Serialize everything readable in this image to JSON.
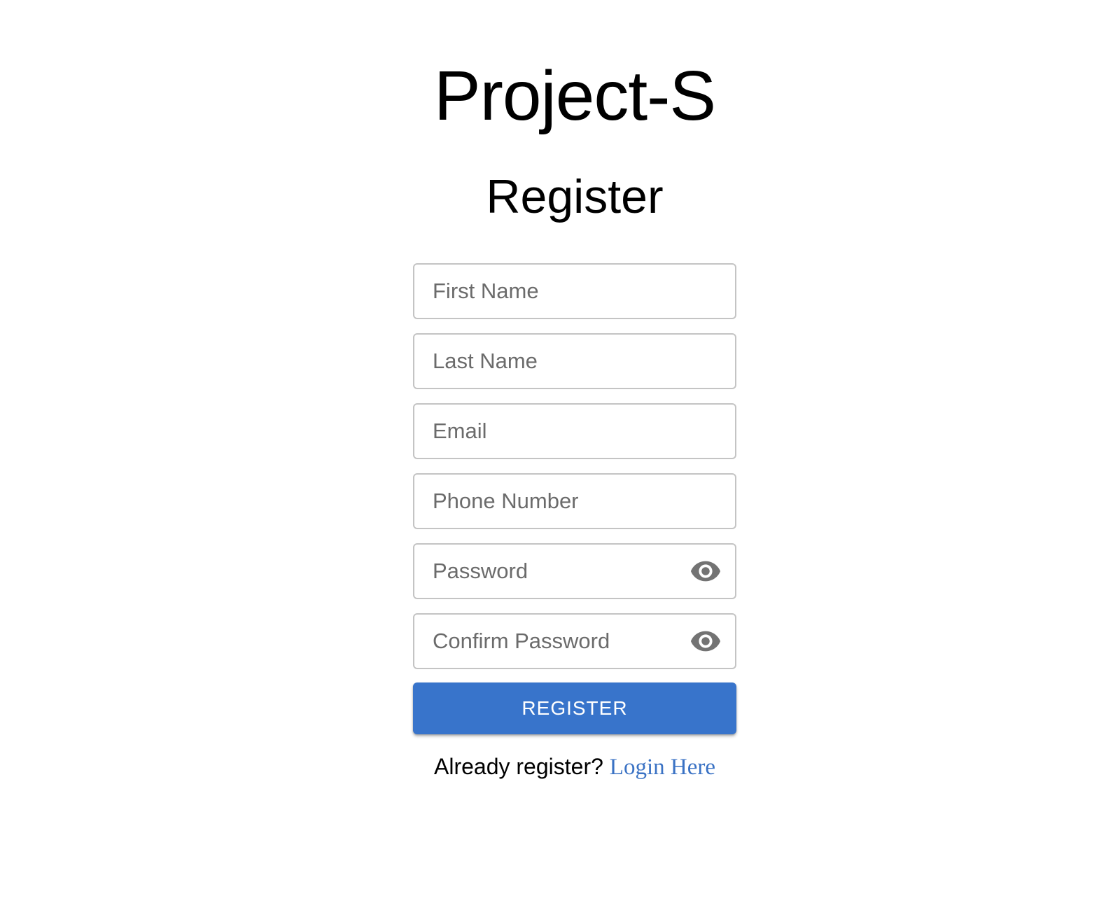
{
  "app": {
    "title": "Project-S"
  },
  "page": {
    "heading": "Register"
  },
  "form": {
    "fields": [
      {
        "name": "first_name",
        "placeholder": "First Name",
        "value": ""
      },
      {
        "name": "last_name",
        "placeholder": "Last Name",
        "value": ""
      },
      {
        "name": "email",
        "placeholder": "Email",
        "value": ""
      },
      {
        "name": "phone_number",
        "placeholder": "Phone Number",
        "value": ""
      },
      {
        "name": "password",
        "placeholder": "Password",
        "value": "",
        "icon": "eye-icon"
      },
      {
        "name": "confirm_password",
        "placeholder": "Confirm Password",
        "value": "",
        "icon": "eye-icon"
      }
    ],
    "submit_label": "REGISTER"
  },
  "footer": {
    "prompt": "Already register?",
    "link_label": "Login Here"
  },
  "colors": {
    "accent": "#3874cb",
    "link": "#3a72c4",
    "placeholder": "#6b6b6b",
    "border": "#c4c4c4",
    "icon": "#737373"
  }
}
